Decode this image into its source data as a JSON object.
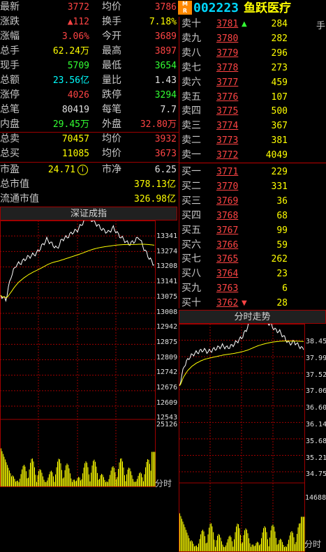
{
  "stock": {
    "code": "002223",
    "name": "鱼跃医疗",
    "badge_top": "M",
    "badge_bottom": "R",
    "badge_t": "T",
    "side_char": "手"
  },
  "quote_rows": [
    {
      "l1": "最新",
      "v1": "3772",
      "c1": "red",
      "l2": "均价",
      "v2": "3786",
      "c2": "red"
    },
    {
      "l1": "涨跌",
      "v1": "▲112",
      "c1": "red",
      "l2": "换手",
      "v2": "7.18%",
      "c2": "yellow"
    },
    {
      "l1": "涨幅",
      "v1": "3.06%",
      "c1": "red",
      "l2": "今开",
      "v2": "3689",
      "c2": "red"
    },
    {
      "l1": "总手",
      "v1": "62.24万",
      "c1": "yellow",
      "l2": "最高",
      "v2": "3897",
      "c2": "red"
    },
    {
      "l1": "现手",
      "v1": "5709",
      "c1": "green",
      "l2": "最低",
      "v2": "3654",
      "c2": "green"
    },
    {
      "l1": "总额",
      "v1": "23.56亿",
      "c1": "cyan",
      "l2": "量比",
      "v2": "1.43",
      "c2": "white"
    },
    {
      "l1": "涨停",
      "v1": "4026",
      "c1": "red",
      "l2": "跌停",
      "v2": "3294",
      "c2": "green"
    },
    {
      "l1": "总笔",
      "v1": "80419",
      "c1": "white",
      "l2": "每笔",
      "v2": "7.7",
      "c2": "white"
    },
    {
      "l1": "内盘",
      "v1": "29.45万",
      "c1": "green",
      "l2": "外盘",
      "v2": "32.80万",
      "c2": "red"
    },
    {
      "l1": "总卖",
      "v1": "70457",
      "c1": "yellow",
      "l2": "均价",
      "v2": "3932",
      "c2": "red"
    },
    {
      "l1": "总买",
      "v1": "11085",
      "c1": "yellow",
      "l2": "均价",
      "v2": "3673",
      "c2": "red"
    },
    {
      "l1": "市盈",
      "v1": "24.71",
      "c1": "yellow",
      "l2": "市净",
      "v2": "6.25",
      "c2": "white"
    },
    {
      "l1": "总市值",
      "v1": "378.13亿",
      "c1": "yellow",
      "l2": "",
      "v2": "",
      "c2": "white"
    },
    {
      "l1": "流通市值",
      "v1": "326.98亿",
      "c1": "yellow",
      "l2": "",
      "v2": "",
      "c2": "white"
    }
  ],
  "pe_info_icon": "i",
  "order_book": [
    {
      "label": "卖十",
      "price": "3781",
      "vol": "284",
      "arrow": "up"
    },
    {
      "label": "卖九",
      "price": "3780",
      "vol": "282",
      "arrow": ""
    },
    {
      "label": "卖八",
      "price": "3779",
      "vol": "296",
      "arrow": ""
    },
    {
      "label": "卖七",
      "price": "3778",
      "vol": "273",
      "arrow": ""
    },
    {
      "label": "卖六",
      "price": "3777",
      "vol": "459",
      "arrow": ""
    },
    {
      "label": "卖五",
      "price": "3776",
      "vol": "107",
      "arrow": ""
    },
    {
      "label": "卖四",
      "price": "3775",
      "vol": "500",
      "arrow": ""
    },
    {
      "label": "卖三",
      "price": "3774",
      "vol": "367",
      "arrow": ""
    },
    {
      "label": "卖二",
      "price": "3773",
      "vol": "381",
      "arrow": ""
    },
    {
      "label": "卖一",
      "price": "3772",
      "vol": "4049",
      "arrow": ""
    },
    {
      "label": "买一",
      "price": "3771",
      "vol": "229",
      "arrow": ""
    },
    {
      "label": "买二",
      "price": "3770",
      "vol": "331",
      "arrow": ""
    },
    {
      "label": "买三",
      "price": "3769",
      "vol": "36",
      "arrow": ""
    },
    {
      "label": "买四",
      "price": "3768",
      "vol": "68",
      "arrow": ""
    },
    {
      "label": "买五",
      "price": "3767",
      "vol": "99",
      "arrow": ""
    },
    {
      "label": "买六",
      "price": "3766",
      "vol": "59",
      "arrow": ""
    },
    {
      "label": "买七",
      "price": "3765",
      "vol": "262",
      "arrow": ""
    },
    {
      "label": "买八",
      "price": "3764",
      "vol": "23",
      "arrow": ""
    },
    {
      "label": "买九",
      "price": "3763",
      "vol": "6",
      "arrow": ""
    },
    {
      "label": "买十",
      "price": "3762",
      "vol": "28",
      "arrow": "down"
    }
  ],
  "index_chart": {
    "title": "深证成指",
    "price_ticks": [
      "13341",
      "13274",
      "13208",
      "13141",
      "13075",
      "13008",
      "12942",
      "12875",
      "12809",
      "12742",
      "12676",
      "12609",
      "12543"
    ],
    "vol_tick": "25126",
    "time_label": "分时"
  },
  "stock_chart": {
    "title": "分时走势",
    "price_ticks": [
      "38.45",
      "37.99",
      "37.52",
      "37.06",
      "36.60",
      "36.14",
      "35.68",
      "35.21",
      "34.75"
    ],
    "vol_tick": "14688",
    "time_label": "分时"
  },
  "colors": {
    "grid": "#a00000",
    "price_line": "#ffffff",
    "avg_line": "#ffff00",
    "volume": "#ffff00"
  },
  "chart_data": [
    {
      "type": "line",
      "title": "深证成指",
      "series": [
        {
          "values": [
            13020,
            13000,
            13100,
            13150,
            13160,
            13180,
            13190,
            13200,
            13230,
            13260,
            13240,
            13220,
            13260,
            13270,
            13290,
            13300,
            13330,
            13360,
            13340,
            13320,
            13300,
            13290,
            13310,
            13280,
            13260,
            13240,
            13250,
            13270,
            13220,
            13180,
            13150
          ]
        }
      ],
      "ylim": [
        12543,
        13341
      ]
    },
    {
      "type": "line",
      "title": "分时走势",
      "series": [
        {
          "values": [
            36.9,
            37.4,
            37.6,
            37.7,
            37.75,
            37.8,
            37.75,
            37.8,
            37.85,
            37.9,
            37.85,
            37.9,
            38.0,
            38.1,
            38.3,
            38.6,
            38.7,
            38.55,
            38.5,
            38.45,
            38.3,
            38.25,
            38.1,
            37.95,
            38.0,
            37.9,
            37.8
          ]
        }
      ],
      "ylim": [
        34.75,
        38.45
      ]
    }
  ]
}
